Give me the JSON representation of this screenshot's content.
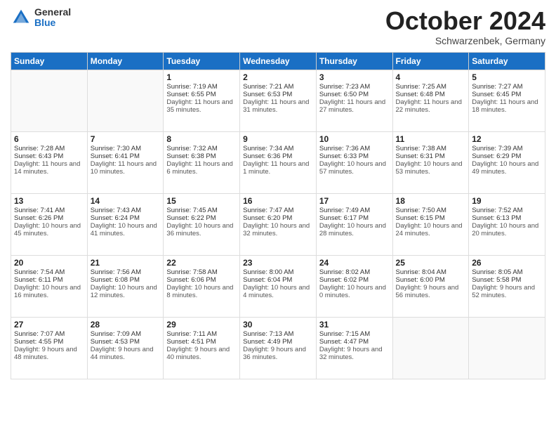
{
  "header": {
    "logo_general": "General",
    "logo_blue": "Blue",
    "month_title": "October 2024",
    "subtitle": "Schwarzenbek, Germany"
  },
  "days_of_week": [
    "Sunday",
    "Monday",
    "Tuesday",
    "Wednesday",
    "Thursday",
    "Friday",
    "Saturday"
  ],
  "weeks": [
    [
      {
        "day": "",
        "sunrise": "",
        "sunset": "",
        "daylight": ""
      },
      {
        "day": "",
        "sunrise": "",
        "sunset": "",
        "daylight": ""
      },
      {
        "day": "1",
        "sunrise": "Sunrise: 7:19 AM",
        "sunset": "Sunset: 6:55 PM",
        "daylight": "Daylight: 11 hours and 35 minutes."
      },
      {
        "day": "2",
        "sunrise": "Sunrise: 7:21 AM",
        "sunset": "Sunset: 6:53 PM",
        "daylight": "Daylight: 11 hours and 31 minutes."
      },
      {
        "day": "3",
        "sunrise": "Sunrise: 7:23 AM",
        "sunset": "Sunset: 6:50 PM",
        "daylight": "Daylight: 11 hours and 27 minutes."
      },
      {
        "day": "4",
        "sunrise": "Sunrise: 7:25 AM",
        "sunset": "Sunset: 6:48 PM",
        "daylight": "Daylight: 11 hours and 22 minutes."
      },
      {
        "day": "5",
        "sunrise": "Sunrise: 7:27 AM",
        "sunset": "Sunset: 6:45 PM",
        "daylight": "Daylight: 11 hours and 18 minutes."
      }
    ],
    [
      {
        "day": "6",
        "sunrise": "Sunrise: 7:28 AM",
        "sunset": "Sunset: 6:43 PM",
        "daylight": "Daylight: 11 hours and 14 minutes."
      },
      {
        "day": "7",
        "sunrise": "Sunrise: 7:30 AM",
        "sunset": "Sunset: 6:41 PM",
        "daylight": "Daylight: 11 hours and 10 minutes."
      },
      {
        "day": "8",
        "sunrise": "Sunrise: 7:32 AM",
        "sunset": "Sunset: 6:38 PM",
        "daylight": "Daylight: 11 hours and 6 minutes."
      },
      {
        "day": "9",
        "sunrise": "Sunrise: 7:34 AM",
        "sunset": "Sunset: 6:36 PM",
        "daylight": "Daylight: 11 hours and 1 minute."
      },
      {
        "day": "10",
        "sunrise": "Sunrise: 7:36 AM",
        "sunset": "Sunset: 6:33 PM",
        "daylight": "Daylight: 10 hours and 57 minutes."
      },
      {
        "day": "11",
        "sunrise": "Sunrise: 7:38 AM",
        "sunset": "Sunset: 6:31 PM",
        "daylight": "Daylight: 10 hours and 53 minutes."
      },
      {
        "day": "12",
        "sunrise": "Sunrise: 7:39 AM",
        "sunset": "Sunset: 6:29 PM",
        "daylight": "Daylight: 10 hours and 49 minutes."
      }
    ],
    [
      {
        "day": "13",
        "sunrise": "Sunrise: 7:41 AM",
        "sunset": "Sunset: 6:26 PM",
        "daylight": "Daylight: 10 hours and 45 minutes."
      },
      {
        "day": "14",
        "sunrise": "Sunrise: 7:43 AM",
        "sunset": "Sunset: 6:24 PM",
        "daylight": "Daylight: 10 hours and 41 minutes."
      },
      {
        "day": "15",
        "sunrise": "Sunrise: 7:45 AM",
        "sunset": "Sunset: 6:22 PM",
        "daylight": "Daylight: 10 hours and 36 minutes."
      },
      {
        "day": "16",
        "sunrise": "Sunrise: 7:47 AM",
        "sunset": "Sunset: 6:20 PM",
        "daylight": "Daylight: 10 hours and 32 minutes."
      },
      {
        "day": "17",
        "sunrise": "Sunrise: 7:49 AM",
        "sunset": "Sunset: 6:17 PM",
        "daylight": "Daylight: 10 hours and 28 minutes."
      },
      {
        "day": "18",
        "sunrise": "Sunrise: 7:50 AM",
        "sunset": "Sunset: 6:15 PM",
        "daylight": "Daylight: 10 hours and 24 minutes."
      },
      {
        "day": "19",
        "sunrise": "Sunrise: 7:52 AM",
        "sunset": "Sunset: 6:13 PM",
        "daylight": "Daylight: 10 hours and 20 minutes."
      }
    ],
    [
      {
        "day": "20",
        "sunrise": "Sunrise: 7:54 AM",
        "sunset": "Sunset: 6:11 PM",
        "daylight": "Daylight: 10 hours and 16 minutes."
      },
      {
        "day": "21",
        "sunrise": "Sunrise: 7:56 AM",
        "sunset": "Sunset: 6:08 PM",
        "daylight": "Daylight: 10 hours and 12 minutes."
      },
      {
        "day": "22",
        "sunrise": "Sunrise: 7:58 AM",
        "sunset": "Sunset: 6:06 PM",
        "daylight": "Daylight: 10 hours and 8 minutes."
      },
      {
        "day": "23",
        "sunrise": "Sunrise: 8:00 AM",
        "sunset": "Sunset: 6:04 PM",
        "daylight": "Daylight: 10 hours and 4 minutes."
      },
      {
        "day": "24",
        "sunrise": "Sunrise: 8:02 AM",
        "sunset": "Sunset: 6:02 PM",
        "daylight": "Daylight: 10 hours and 0 minutes."
      },
      {
        "day": "25",
        "sunrise": "Sunrise: 8:04 AM",
        "sunset": "Sunset: 6:00 PM",
        "daylight": "Daylight: 9 hours and 56 minutes."
      },
      {
        "day": "26",
        "sunrise": "Sunrise: 8:05 AM",
        "sunset": "Sunset: 5:58 PM",
        "daylight": "Daylight: 9 hours and 52 minutes."
      }
    ],
    [
      {
        "day": "27",
        "sunrise": "Sunrise: 7:07 AM",
        "sunset": "Sunset: 4:55 PM",
        "daylight": "Daylight: 9 hours and 48 minutes."
      },
      {
        "day": "28",
        "sunrise": "Sunrise: 7:09 AM",
        "sunset": "Sunset: 4:53 PM",
        "daylight": "Daylight: 9 hours and 44 minutes."
      },
      {
        "day": "29",
        "sunrise": "Sunrise: 7:11 AM",
        "sunset": "Sunset: 4:51 PM",
        "daylight": "Daylight: 9 hours and 40 minutes."
      },
      {
        "day": "30",
        "sunrise": "Sunrise: 7:13 AM",
        "sunset": "Sunset: 4:49 PM",
        "daylight": "Daylight: 9 hours and 36 minutes."
      },
      {
        "day": "31",
        "sunrise": "Sunrise: 7:15 AM",
        "sunset": "Sunset: 4:47 PM",
        "daylight": "Daylight: 9 hours and 32 minutes."
      },
      {
        "day": "",
        "sunrise": "",
        "sunset": "",
        "daylight": ""
      },
      {
        "day": "",
        "sunrise": "",
        "sunset": "",
        "daylight": ""
      }
    ]
  ]
}
